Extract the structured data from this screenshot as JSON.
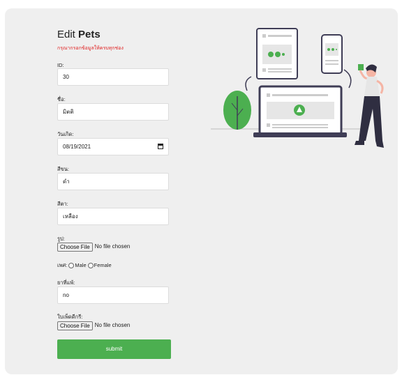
{
  "form": {
    "title_prefix": "Edit ",
    "title_bold": "Pets",
    "subtitle": "กรุณากรอกข้อมูลให้ครบทุกช่อง",
    "id_label": "ID:",
    "id_value": "30",
    "name_label": "ชื่อ:",
    "name_value": "มิตติ",
    "birth_label": "วันเกิด:",
    "birth_value": "08/19/2021",
    "color1_label": "สีขน:",
    "color1_value": "ดำ",
    "color2_label": "สีตา:",
    "color2_value": "เหลือง",
    "picture_label": "รูป:",
    "choose_file": "Choose File",
    "no_file": "No file chosen",
    "sex_label": "เพศ:",
    "male": "Male",
    "female": "Female",
    "allergy_label": "ยาที่แพ้:",
    "allergy_value": "no",
    "cert_label": "ใบเพ็ดดีกรี:",
    "submit": "submit"
  },
  "colors": {
    "accent": "#4caf50",
    "warning": "#e02020",
    "card_bg": "#efefef",
    "illustration_green": "#4caf50"
  }
}
